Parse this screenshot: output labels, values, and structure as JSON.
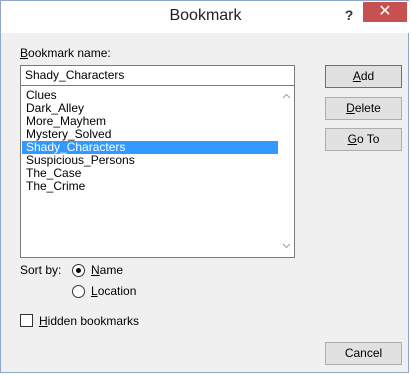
{
  "dialog": {
    "title": "Bookmark",
    "help_label": "?",
    "close_label": "✕"
  },
  "bookmark": {
    "name_label": "Bookmark name:",
    "name_value": "Shady_Characters",
    "items": [
      "Clues",
      "Dark_Alley",
      "More_Mayhem",
      "Mystery_Solved",
      "Shady_Characters",
      "Suspicious_Persons",
      "The_Case",
      "The_Crime"
    ],
    "selected_item": "Shady_Characters"
  },
  "buttons": {
    "add": "Add",
    "delete": "Delete",
    "goto": "Go To",
    "cancel": "Cancel"
  },
  "sort": {
    "label": "Sort by:",
    "options": [
      "Name",
      "Location"
    ],
    "selected": "Name"
  },
  "hidden": {
    "label": "Hidden bookmarks",
    "checked": false
  },
  "icons": {
    "scroll_up": "chevron-up-icon",
    "scroll_down": "chevron-down-icon"
  },
  "colors": {
    "selection": "#3399ff",
    "close_button": "#c75050"
  }
}
